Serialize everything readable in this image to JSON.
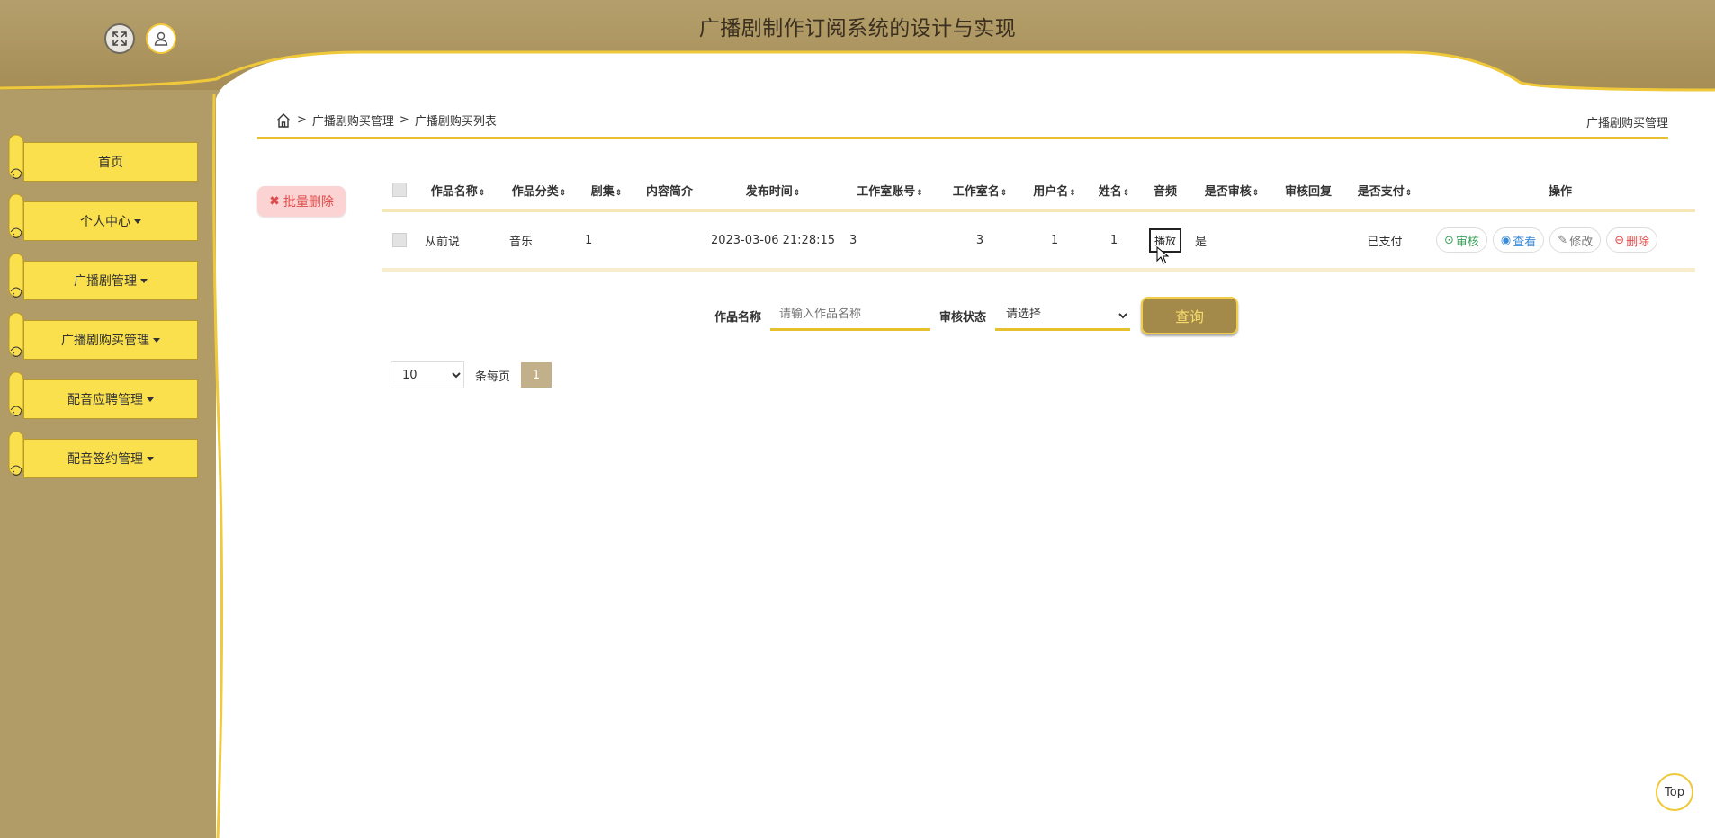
{
  "header": {
    "title": "广播剧制作订阅系统的设计与实现"
  },
  "sidebar": {
    "items": [
      {
        "label": "首页",
        "has_dropdown": false
      },
      {
        "label": "个人中心",
        "has_dropdown": true
      },
      {
        "label": "广播剧管理",
        "has_dropdown": true
      },
      {
        "label": "广播剧购买管理",
        "has_dropdown": true
      },
      {
        "label": "配音应聘管理",
        "has_dropdown": true
      },
      {
        "label": "配音签约管理",
        "has_dropdown": true
      }
    ]
  },
  "breadcrumb": {
    "sep": ">",
    "level1": "广播剧购买管理",
    "level2": "广播剧购买列表"
  },
  "page_title_right": "广播剧购买管理",
  "toolbar": {
    "batch_delete": "批量删除"
  },
  "table": {
    "sort_glyph": "⇕",
    "columns": [
      "作品名称",
      "作品分类",
      "剧集",
      "内容简介",
      "发布时间",
      "工作室账号",
      "工作室名",
      "用户名",
      "姓名",
      "音频",
      "是否审核",
      "审核回复",
      "是否支付",
      "操作"
    ],
    "rows": [
      {
        "name": "从前说",
        "category": "音乐",
        "episode": "1",
        "intro": "",
        "publish_time": "2023-03-06 21:28:15",
        "studio_account": "3",
        "studio_name": "3",
        "username": "1",
        "realname": "1",
        "audio_btn": "播放",
        "audited": "是",
        "audit_reply": "",
        "paid": "已支付"
      }
    ],
    "actions": {
      "audit": "审核",
      "view": "查看",
      "edit": "修改",
      "delete": "删除"
    }
  },
  "search": {
    "name_label": "作品名称",
    "name_placeholder": "请输入作品名称",
    "status_label": "审核状态",
    "status_selected": "请选择",
    "query_button": "查询"
  },
  "pager": {
    "page_size": "10",
    "per_page_label": "条每页",
    "current_page": "1"
  },
  "top_button": "Top",
  "colors": {
    "gold": "#e6c12d",
    "brown": "#a48a4a",
    "sidebar_bg": "#b19b66",
    "menu_yellow": "#fbe04d"
  }
}
